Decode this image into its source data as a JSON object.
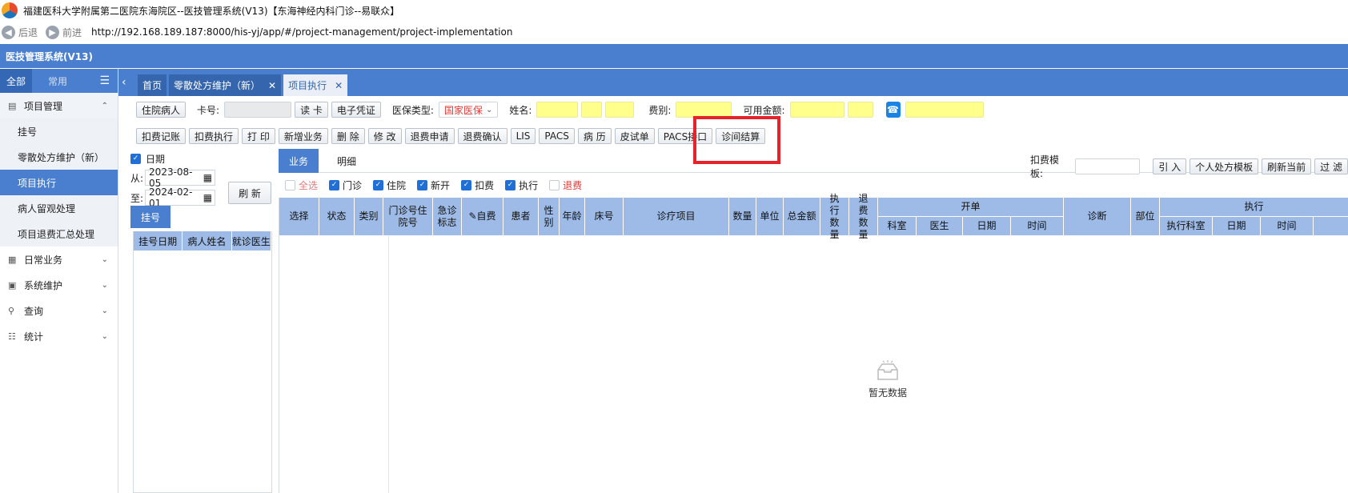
{
  "window": {
    "title": "福建医科大学附属第二医院东海院区--医技管理系统(V13)【东海神经内科门诊--易联众】",
    "back_label": "后退",
    "forward_label": "前进",
    "url": "http://192.168.189.187:8000/his-yj/app/#/project-management/project-implementation"
  },
  "app": {
    "header_title": "医技管理系统(V13)"
  },
  "sidebar": {
    "tab_all": "全部",
    "tab_common": "常用",
    "groups": [
      {
        "label": "项目管理",
        "icon": "project-icon",
        "open": true,
        "items": [
          "挂号",
          "零散处方维护（新）",
          "项目执行",
          "病人留观处理",
          "项目退费汇总处理"
        ]
      },
      {
        "label": "日常业务",
        "icon": "daily-icon"
      },
      {
        "label": "系统维护",
        "icon": "system-icon"
      },
      {
        "label": "查询",
        "icon": "search-icon"
      },
      {
        "label": "统计",
        "icon": "stats-icon"
      }
    ],
    "active_item": "项目执行"
  },
  "tabs": [
    "首页",
    "零散处方维护（新）",
    "项目执行"
  ],
  "form": {
    "inpatient_button": "住院病人",
    "card_label": "卡号:",
    "card_value": "",
    "read_card_button": "读 卡",
    "e_voucher_button": "电子凭证",
    "insurance_label": "医保类型:",
    "insurance_value": "国家医保",
    "name_label": "姓名:",
    "fee_type_label": "费别:",
    "balance_label": "可用金额:"
  },
  "toolbar": [
    "扣费记账",
    "扣费执行",
    "打 印",
    "新增业务",
    "删 除",
    "修 改",
    "退费申请",
    "退费确认",
    "LIS",
    "PACS",
    "病 历",
    "皮试单",
    "PACS接口",
    "诊间结算"
  ],
  "date_filter": {
    "label": "日期",
    "from_label": "从:",
    "from_value": "2023-08-05",
    "to_label": "至:",
    "to_value": "2024-02-01",
    "refresh_button": "刷 新"
  },
  "registration": {
    "header": "挂号",
    "columns": [
      "挂号日期",
      "病人姓名",
      "就诊医生"
    ]
  },
  "right_tabs": [
    "业务",
    "明细"
  ],
  "template": {
    "label": "扣费模板:",
    "import_button": "引 入",
    "personal_button": "个人处方模板",
    "refresh_current_button": "刷新当前",
    "filter_button": "过 滤"
  },
  "filters": [
    {
      "label": "全选",
      "checked": false
    },
    {
      "label": "门诊",
      "checked": true
    },
    {
      "label": "住院",
      "checked": true
    },
    {
      "label": "新开",
      "checked": true
    },
    {
      "label": "扣费",
      "checked": true
    },
    {
      "label": "执行",
      "checked": true
    },
    {
      "label": "退费",
      "checked": false
    }
  ],
  "grid": {
    "columns": {
      "select": "选择",
      "status": "状态",
      "category": "类别",
      "visit_no": "门诊号住院号",
      "emergency": "急诊标志",
      "self_pay": "自费",
      "patient": "患者",
      "sex": "性别",
      "age": "年龄",
      "bed": "床号",
      "item": "诊疗项目",
      "qty": "数量",
      "unit": "单位",
      "total": "总金额",
      "exec_qty": "执行数量",
      "refund_qty": "退费数量",
      "order_group": "开单",
      "order_dept": "科室",
      "order_doctor": "医生",
      "order_date": "日期",
      "order_time": "时间",
      "diagnosis": "诊断",
      "site": "部位",
      "exec_group": "执行",
      "exec_dept": "执行科室",
      "exec_date": "日期",
      "exec_time": "时间"
    },
    "empty_text": "暂无数据"
  },
  "colors": {
    "brand": "#4a7fcf",
    "highlight_box": "#e6222b",
    "field_yellow": "#ffff8c"
  }
}
